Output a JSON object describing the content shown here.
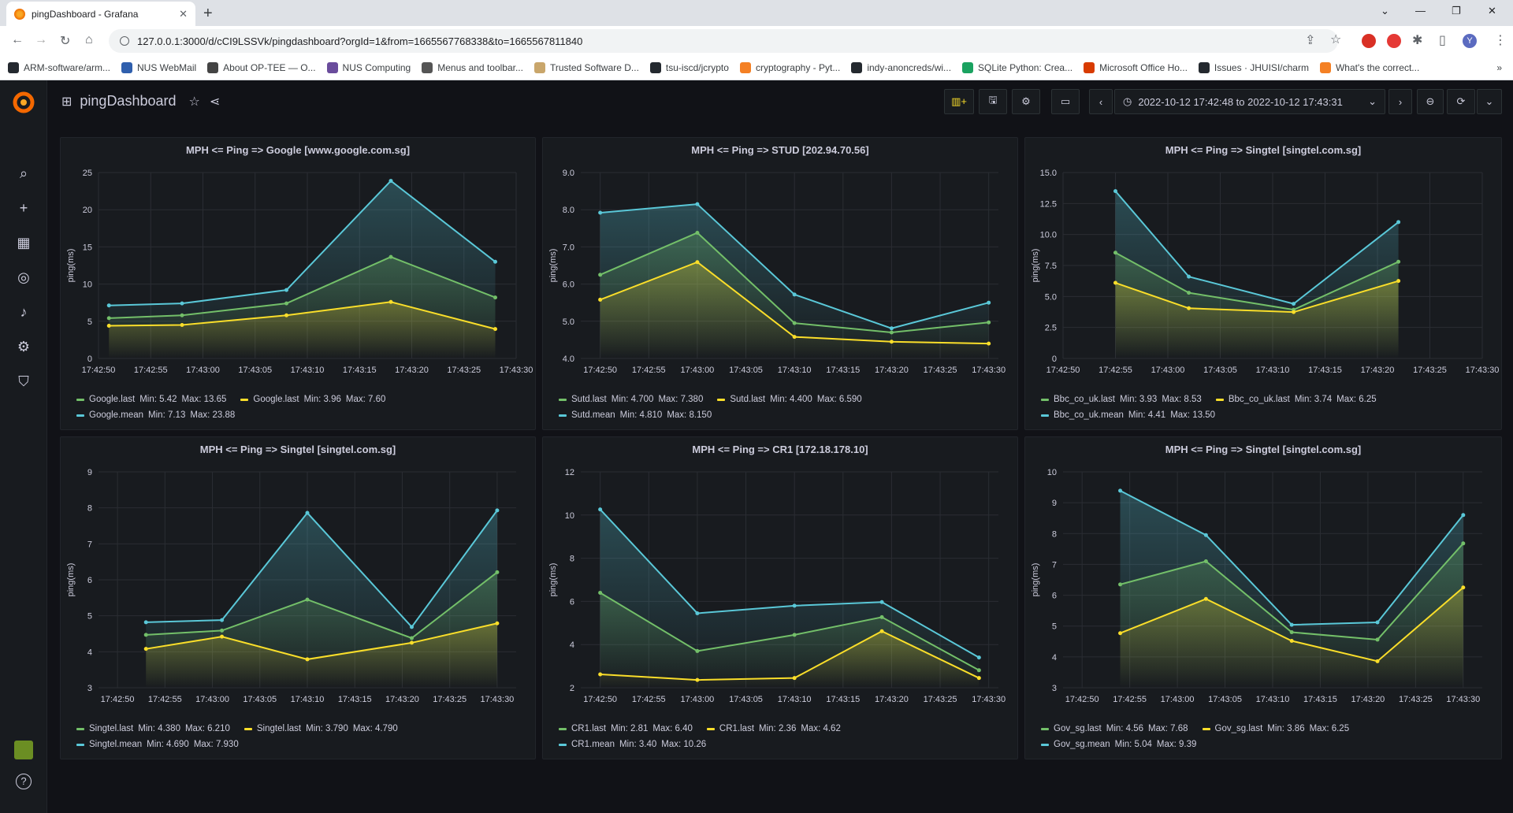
{
  "browser": {
    "tab_title": "pingDashboard - Grafana",
    "url": "127.0.0.1:3000/d/cCI9LSSVk/pingdashboard?orgId=1&from=1665567768338&to=1665567811840",
    "bookmarks": [
      {
        "label": "ARM-software/arm...",
        "color": "#24292f"
      },
      {
        "label": "NUS WebMail",
        "color": "#2f5fad"
      },
      {
        "label": "About OP-TEE — O...",
        "color": "#444"
      },
      {
        "label": "NUS Computing",
        "color": "#6a4c9c"
      },
      {
        "label": "Menus and toolbar...",
        "color": "#555"
      },
      {
        "label": "Trusted Software D...",
        "color": "#c9a66b"
      },
      {
        "label": "tsu-iscd/jcrypto",
        "color": "#24292f"
      },
      {
        "label": "cryptography - Pyt...",
        "color": "#f48024"
      },
      {
        "label": "indy-anoncreds/wi...",
        "color": "#24292f"
      },
      {
        "label": "SQLite Python: Crea...",
        "color": "#1aa260"
      },
      {
        "label": "Microsoft Office Ho...",
        "color": "#d83b01"
      },
      {
        "label": "Issues · JHUISI/charm",
        "color": "#24292f"
      },
      {
        "label": "What's the correct...",
        "color": "#f48024"
      }
    ],
    "profile_initial": "Y"
  },
  "grafana": {
    "dashboard_title": "pingDashboard",
    "time_range": "2022-10-12 17:42:48 to 2022-10-12 17:43:31",
    "sidebar_icons": [
      "search-icon",
      "plus-icon",
      "dashboards-icon",
      "explore-icon",
      "alerting-icon",
      "configuration-icon",
      "server-admin-icon"
    ],
    "help_icon": "help-icon"
  },
  "colors": {
    "green": "#73bf69",
    "yellow": "#fade2a",
    "blue": "#5ac8d8"
  },
  "panels": [
    {
      "title": "MPH <= Ping => Google [www.google.com.sg]",
      "ylabel": "ping(ms)",
      "ylim": [
        0,
        25
      ],
      "yticks": [
        "0",
        "5",
        "10",
        "15",
        "20",
        "25"
      ],
      "xticks": [
        "17:42:50",
        "17:42:55",
        "17:43:00",
        "17:43:05",
        "17:43:10",
        "17:43:15",
        "17:43:20",
        "17:43:25",
        "17:43:30"
      ],
      "legend": [
        {
          "name": "Google.last",
          "color": "green",
          "min": "Min: 5.42",
          "max": "Max: 13.65"
        },
        {
          "name": "Google.last",
          "color": "yellow",
          "min": "Min: 3.96",
          "max": "Max: 7.60"
        },
        {
          "name": "Google.mean",
          "color": "blue",
          "min": "Min: 7.13",
          "max": "Max: 23.88"
        }
      ]
    },
    {
      "title": "MPH <= Ping => STUD [202.94.70.56]",
      "ylabel": "ping(ms)",
      "ylim": [
        4,
        9
      ],
      "yticks": [
        "4.0",
        "5.0",
        "6.0",
        "7.0",
        "8.0",
        "9.0"
      ],
      "xticks": [
        "17:42:50",
        "17:42:55",
        "17:43:00",
        "17:43:05",
        "17:43:10",
        "17:43:15",
        "17:43:20",
        "17:43:25",
        "17:43:30"
      ],
      "legend": [
        {
          "name": "Sutd.last",
          "color": "green",
          "min": "Min: 4.700",
          "max": "Max: 7.380"
        },
        {
          "name": "Sutd.last",
          "color": "yellow",
          "min": "Min: 4.400",
          "max": "Max: 6.590"
        },
        {
          "name": "Sutd.mean",
          "color": "blue",
          "min": "Min: 4.810",
          "max": "Max: 8.150"
        }
      ]
    },
    {
      "title": "MPH <= Ping => Singtel [singtel.com.sg]",
      "ylabel": "ping(ms)",
      "ylim": [
        0,
        15
      ],
      "yticks": [
        "0",
        "2.5",
        "5.0",
        "7.5",
        "10.0",
        "12.5",
        "15.0"
      ],
      "xticks": [
        "17:42:50",
        "17:42:55",
        "17:43:00",
        "17:43:05",
        "17:43:10",
        "17:43:15",
        "17:43:20",
        "17:43:25",
        "17:43:30"
      ],
      "legend": [
        {
          "name": "Bbc_co_uk.last",
          "color": "green",
          "min": "Min: 3.93",
          "max": "Max: 8.53"
        },
        {
          "name": "Bbc_co_uk.last",
          "color": "yellow",
          "min": "Min: 3.74",
          "max": "Max: 6.25"
        },
        {
          "name": "Bbc_co_uk.mean",
          "color": "blue",
          "min": "Min: 4.41",
          "max": "Max: 13.50"
        }
      ]
    },
    {
      "title": "MPH <= Ping => Singtel [singtel.com.sg]",
      "ylabel": "ping(ms)",
      "ylim": [
        3,
        9
      ],
      "yticks": [
        "3",
        "4",
        "5",
        "6",
        "7",
        "8",
        "9"
      ],
      "xticks": [
        "17:42:50",
        "17:42:55",
        "17:43:00",
        "17:43:05",
        "17:43:10",
        "17:43:15",
        "17:43:20",
        "17:43:25",
        "17:43:30"
      ],
      "legend": [
        {
          "name": "Singtel.last",
          "color": "green",
          "min": "Min: 4.380",
          "max": "Max: 6.210"
        },
        {
          "name": "Singtel.last",
          "color": "yellow",
          "min": "Min: 3.790",
          "max": "Max: 4.790"
        },
        {
          "name": "Singtel.mean",
          "color": "blue",
          "min": "Min: 4.690",
          "max": "Max: 7.930"
        }
      ]
    },
    {
      "title": "MPH <= Ping => CR1 [172.18.178.10]",
      "ylabel": "ping(ms)",
      "ylim": [
        2,
        12
      ],
      "yticks": [
        "2",
        "4",
        "6",
        "8",
        "10",
        "12"
      ],
      "xticks": [
        "17:42:50",
        "17:42:55",
        "17:43:00",
        "17:43:05",
        "17:43:10",
        "17:43:15",
        "17:43:20",
        "17:43:25",
        "17:43:30"
      ],
      "legend": [
        {
          "name": "CR1.last",
          "color": "green",
          "min": "Min: 2.81",
          "max": "Max: 6.40"
        },
        {
          "name": "CR1.last",
          "color": "yellow",
          "min": "Min: 2.36",
          "max": "Max: 4.62"
        },
        {
          "name": "CR1.mean",
          "color": "blue",
          "min": "Min: 3.40",
          "max": "Max: 10.26"
        }
      ]
    },
    {
      "title": "MPH <= Ping => Singtel [singtel.com.sg]",
      "ylabel": "ping(ms)",
      "ylim": [
        3,
        10
      ],
      "yticks": [
        "3",
        "4",
        "5",
        "6",
        "7",
        "8",
        "9",
        "10"
      ],
      "xticks": [
        "17:42:50",
        "17:42:55",
        "17:43:00",
        "17:43:05",
        "17:43:10",
        "17:43:15",
        "17:43:20",
        "17:43:25",
        "17:43:30"
      ],
      "legend": [
        {
          "name": "Gov_sg.last",
          "color": "green",
          "min": "Min: 4.56",
          "max": "Max: 7.68"
        },
        {
          "name": "Gov_sg.last",
          "color": "yellow",
          "min": "Min: 3.86",
          "max": "Max: 6.25"
        },
        {
          "name": "Gov_sg.mean",
          "color": "blue",
          "min": "Min: 5.04",
          "max": "Max: 9.39"
        }
      ]
    }
  ],
  "chart_data": [
    {
      "type": "line",
      "title": "MPH <= Ping => Google [www.google.com.sg]",
      "ylabel": "ping(ms)",
      "ylim": [
        0,
        25
      ],
      "x": [
        "17:42:51",
        "17:42:56",
        "17:43:01",
        "17:43:06",
        "17:43:11",
        "17:43:16",
        "17:43:21"
      ],
      "xlim": [
        "17:42:50",
        "17:43:30"
      ],
      "series": [
        {
          "name": "Google.last",
          "color": "green",
          "values": [
            5.42,
            5.8,
            7.4,
            13.65,
            8.2
          ]
        },
        {
          "name": "Google.last",
          "color": "yellow",
          "values": [
            4.4,
            4.5,
            5.8,
            7.6,
            3.96
          ]
        },
        {
          "name": "Google.mean",
          "color": "blue",
          "values": [
            7.13,
            7.4,
            9.2,
            23.88,
            13.0
          ]
        }
      ],
      "x_points": [
        "17:42:51",
        "17:42:58",
        "17:43:08",
        "17:43:18",
        "17:43:28"
      ]
    },
    {
      "type": "line",
      "title": "MPH <= Ping => STUD [202.94.70.56]",
      "ylabel": "ping(ms)",
      "ylim": [
        4,
        9
      ],
      "x_points": [
        "17:42:50",
        "17:43:00",
        "17:43:10",
        "17:43:20",
        "17:43:30"
      ],
      "xlim": [
        "17:42:48",
        "17:43:31"
      ],
      "series": [
        {
          "name": "Sutd.last",
          "color": "green",
          "values": [
            6.25,
            7.38,
            4.95,
            4.7,
            4.97
          ]
        },
        {
          "name": "Sutd.last",
          "color": "yellow",
          "values": [
            5.58,
            6.59,
            4.58,
            4.45,
            4.4
          ]
        },
        {
          "name": "Sutd.mean",
          "color": "blue",
          "values": [
            7.92,
            8.15,
            5.72,
            4.81,
            5.5
          ]
        }
      ]
    },
    {
      "type": "line",
      "title": "MPH <= Ping => Singtel [singtel.com.sg]",
      "ylabel": "ping(ms)",
      "ylim": [
        0,
        15
      ],
      "x_points": [
        "17:42:55",
        "17:43:02",
        "17:43:12",
        "17:43:22"
      ],
      "xlim": [
        "17:42:50",
        "17:43:30"
      ],
      "series": [
        {
          "name": "Bbc_co_uk.last",
          "color": "green",
          "values": [
            8.53,
            5.3,
            3.93,
            7.8
          ]
        },
        {
          "name": "Bbc_co_uk.last",
          "color": "yellow",
          "values": [
            6.1,
            4.05,
            3.74,
            6.25
          ]
        },
        {
          "name": "Bbc_co_uk.mean",
          "color": "blue",
          "values": [
            13.5,
            6.6,
            4.41,
            11.0
          ]
        }
      ]
    },
    {
      "type": "line",
      "title": "MPH <= Ping => Singtel [singtel.com.sg]",
      "ylabel": "ping(ms)",
      "ylim": [
        3,
        9
      ],
      "x_points": [
        "17:42:53",
        "17:43:01",
        "17:43:10",
        "17:43:21",
        "17:43:30"
      ],
      "xlim": [
        "17:42:48",
        "17:43:32"
      ],
      "series": [
        {
          "name": "Singtel.last",
          "color": "green",
          "values": [
            4.47,
            4.59,
            5.45,
            4.38,
            6.21
          ]
        },
        {
          "name": "Singtel.last",
          "color": "yellow",
          "values": [
            4.08,
            4.42,
            3.79,
            4.25,
            4.79
          ]
        },
        {
          "name": "Singtel.mean",
          "color": "blue",
          "values": [
            4.82,
            4.88,
            7.86,
            4.69,
            7.93
          ]
        }
      ]
    },
    {
      "type": "line",
      "title": "MPH <= Ping => CR1 [172.18.178.10]",
      "ylabel": "ping(ms)",
      "ylim": [
        2,
        12
      ],
      "x_points": [
        "17:42:50",
        "17:43:00",
        "17:43:10",
        "17:43:19",
        "17:43:29"
      ],
      "xlim": [
        "17:42:48",
        "17:43:31"
      ],
      "series": [
        {
          "name": "CR1.last",
          "color": "green",
          "values": [
            6.4,
            3.7,
            4.45,
            5.27,
            2.81
          ]
        },
        {
          "name": "CR1.last",
          "color": "yellow",
          "values": [
            2.62,
            2.36,
            2.45,
            4.62,
            2.45
          ]
        },
        {
          "name": "CR1.mean",
          "color": "blue",
          "values": [
            10.26,
            5.45,
            5.8,
            5.97,
            3.4
          ]
        }
      ]
    },
    {
      "type": "line",
      "title": "MPH <= Ping => Singtel [singtel.com.sg]",
      "ylabel": "ping(ms)",
      "ylim": [
        3,
        10
      ],
      "x_points": [
        "17:42:54",
        "17:43:03",
        "17:43:12",
        "17:43:21",
        "17:43:30"
      ],
      "xlim": [
        "17:42:48",
        "17:43:32"
      ],
      "series": [
        {
          "name": "Gov_sg.last",
          "color": "green",
          "values": [
            6.35,
            7.1,
            4.8,
            4.56,
            7.68
          ]
        },
        {
          "name": "Gov_sg.last",
          "color": "yellow",
          "values": [
            4.77,
            5.88,
            4.52,
            3.86,
            6.25
          ]
        },
        {
          "name": "Gov_sg.mean",
          "color": "blue",
          "values": [
            9.39,
            7.95,
            5.04,
            5.12,
            8.6
          ]
        }
      ]
    }
  ]
}
